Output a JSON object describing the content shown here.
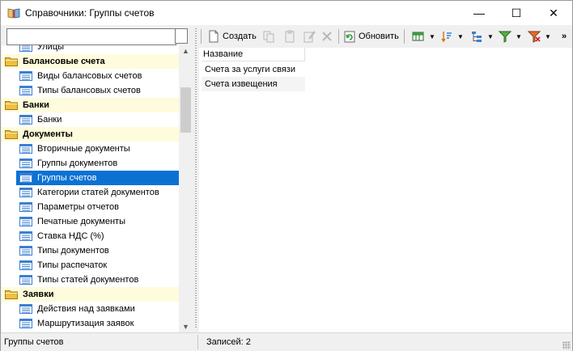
{
  "window": {
    "title": "Справочники: Группы счетов",
    "controls": {
      "minimize": "—",
      "maximize": "☐",
      "close": "✕"
    }
  },
  "search": {
    "value": "",
    "placeholder": ""
  },
  "tree": [
    {
      "kind": "item",
      "label": "Улицы",
      "y": -7
    },
    {
      "kind": "group",
      "label": "Балансовые счета"
    },
    {
      "kind": "item",
      "label": "Виды балансовых счетов"
    },
    {
      "kind": "item",
      "label": "Типы балансовых счетов"
    },
    {
      "kind": "group",
      "label": "Банки"
    },
    {
      "kind": "item",
      "label": "Банки"
    },
    {
      "kind": "group",
      "label": "Документы"
    },
    {
      "kind": "item",
      "label": "Вторичные документы"
    },
    {
      "kind": "item",
      "label": "Группы документов"
    },
    {
      "kind": "item",
      "label": "Группы счетов",
      "selected": true
    },
    {
      "kind": "item",
      "label": "Категории статей документов"
    },
    {
      "kind": "item",
      "label": "Параметры отчетов"
    },
    {
      "kind": "item",
      "label": "Печатные документы"
    },
    {
      "kind": "item",
      "label": "Ставка НДС (%)"
    },
    {
      "kind": "item",
      "label": "Типы документов"
    },
    {
      "kind": "item",
      "label": "Типы распечаток"
    },
    {
      "kind": "item",
      "label": "Типы статей документов"
    },
    {
      "kind": "group",
      "label": "Заявки"
    },
    {
      "kind": "item",
      "label": "Действия над заявками"
    },
    {
      "kind": "item",
      "label": "Маршрутизация заявок"
    }
  ],
  "toolbar": {
    "create_label": "Создать",
    "refresh_label": "Обновить",
    "overflow": "»"
  },
  "grid": {
    "column": "Название",
    "rows": [
      "Счета за услуги связи",
      "Счета извещения"
    ]
  },
  "status": {
    "left": "Группы счетов",
    "right": "Записей: 2"
  },
  "colors": {
    "selection": "#0b72d4",
    "group_bg": "#fefcdc",
    "folder": "#f0c040",
    "list_icon": "#3b7fd1"
  }
}
